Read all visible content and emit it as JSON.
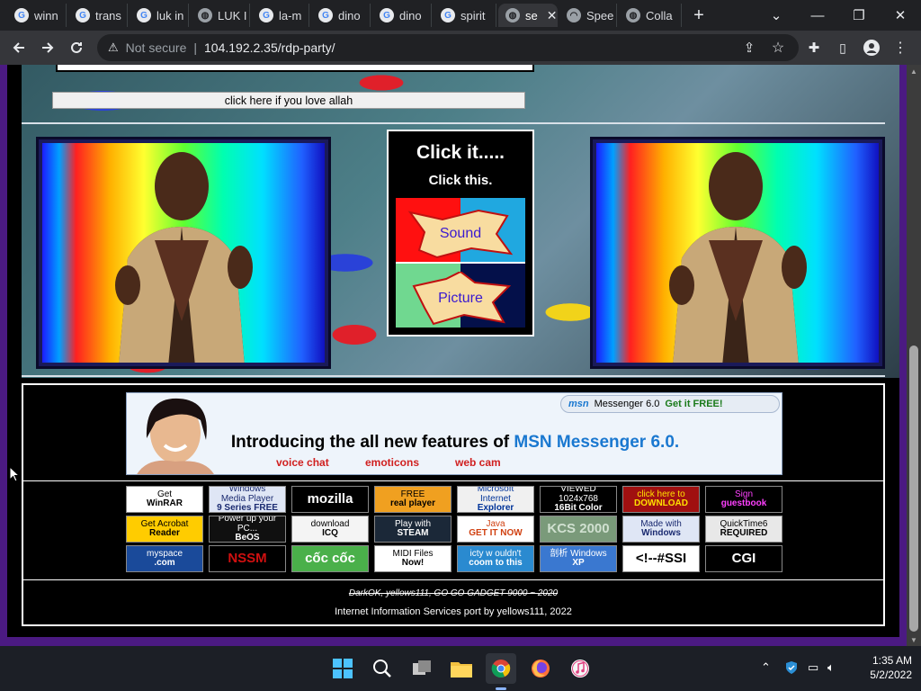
{
  "browser": {
    "tabs": [
      {
        "label": "winn",
        "icon": "google-icon"
      },
      {
        "label": "trans",
        "icon": "google-icon"
      },
      {
        "label": "luk in",
        "icon": "google-icon"
      },
      {
        "label": "LUK I",
        "icon": "globe-icon"
      },
      {
        "label": "la-m",
        "icon": "google-icon"
      },
      {
        "label": "dino",
        "icon": "google-icon"
      },
      {
        "label": "dino",
        "icon": "google-icon"
      },
      {
        "label": "spirit",
        "icon": "google-icon"
      },
      {
        "label": "se",
        "icon": "globe-icon",
        "active": true
      },
      {
        "label": "Spee",
        "icon": "speed-icon"
      },
      {
        "label": "Colla",
        "icon": "globe-icon"
      }
    ],
    "new_tab": "+",
    "security_label": "Not secure",
    "url": "104.192.2.35/rdp-party/",
    "window_controls": {
      "dropdown": "⌄",
      "minimize": "—",
      "restore": "❐",
      "close": "✕"
    }
  },
  "page": {
    "love_button_label": "click here if you love allah",
    "click_box": {
      "title": "Click it.....",
      "subtitle": "Click this.",
      "sound_label": "Sound",
      "picture_label": "Picture"
    },
    "msn_banner": {
      "tag_brand": "msn",
      "tag_product": "Messenger 6.0",
      "tag_free": "Get it FREE!",
      "headline_prefix": "Introducing the all new features of",
      "headline_highlight": "MSN Messenger 6.0.",
      "links": [
        "voice chat",
        "emoticons",
        "web cam"
      ]
    },
    "badges": [
      {
        "text": [
          "Get",
          "WinRAR"
        ],
        "bg": "#ffffff",
        "fg": "#000000"
      },
      {
        "text": [
          "Windows",
          "Media Player",
          "9 Series FREE"
        ],
        "bg": "#dfe6f5",
        "fg": "#1a2a70"
      },
      {
        "text": [
          "mozilla"
        ],
        "bg": "#000000",
        "fg": "#ffffff"
      },
      {
        "text": [
          "FREE",
          "real player"
        ],
        "bg": "#f0a020",
        "fg": "#000000"
      },
      {
        "text": [
          "Microsoft",
          "Internet",
          "Explorer"
        ],
        "bg": "#f0f0f0",
        "fg": "#003399"
      },
      {
        "text": [
          "VIEWED",
          "1024x768",
          "16Bit Color"
        ],
        "bg": "#000000",
        "fg": "#ffffff"
      },
      {
        "text": [
          "click here to",
          "DOWNLOAD"
        ],
        "bg": "#a01010",
        "fg": "#ffe000"
      },
      {
        "text": [
          "Sign",
          "guestbook"
        ],
        "bg": "#000000",
        "fg": "#ff40ff"
      },
      {
        "text": [
          "Get Acrobat",
          "Reader"
        ],
        "bg": "#ffcc00",
        "fg": "#000000"
      },
      {
        "text": [
          "Power up your PC...",
          "BeOS"
        ],
        "bg": "#101010",
        "fg": "#ffffff"
      },
      {
        "text": [
          "download",
          "ICQ"
        ],
        "bg": "#f4f4f4",
        "fg": "#000000"
      },
      {
        "text": [
          "Play with",
          "STEAM"
        ],
        "bg": "#1b2838",
        "fg": "#ffffff"
      },
      {
        "text": [
          "Java",
          "GET IT NOW"
        ],
        "bg": "#ffffff",
        "fg": "#d04010"
      },
      {
        "text": [
          "KCS 2000"
        ],
        "bg": "#7a9a7a",
        "fg": "#d0e0d0"
      },
      {
        "text": [
          "Made with",
          "Windows"
        ],
        "bg": "#dfe6f5",
        "fg": "#1a2a70"
      },
      {
        "text": [
          "QuickTime6",
          "REQUIRED"
        ],
        "bg": "#e8e8e8",
        "fg": "#000000"
      },
      {
        "text": [
          "myspace",
          ".com"
        ],
        "bg": "#1a4a9a",
        "fg": "#ffffff"
      },
      {
        "text": [
          "NSSM"
        ],
        "bg": "#000000",
        "fg": "#d01010"
      },
      {
        "text": [
          "cốc cốc"
        ],
        "bg": "#4ab04a",
        "fg": "#ffffff"
      },
      {
        "text": [
          "MIDI Files",
          "Now!"
        ],
        "bg": "#ffffff",
        "fg": "#000000"
      },
      {
        "text": [
          "icty w ouldn't",
          "coom to this"
        ],
        "bg": "#2a8ad0",
        "fg": "#ffffff"
      },
      {
        "text": [
          "剖析 Windows",
          "XP"
        ],
        "bg": "#3a78d0",
        "fg": "#ffffff"
      },
      {
        "text": [
          "<!--#SSI"
        ],
        "bg": "#ffffff",
        "fg": "#000000"
      },
      {
        "text": [
          "CGI"
        ],
        "bg": "#000000",
        "fg": "#ffffff"
      }
    ],
    "credit_line1": "DarkOK, yellows111, GO GO GADGET 9000 ~ 2020",
    "credit_line2": "Internet Information Services port by yellows111, 2022"
  },
  "taskbar": {
    "clock_time": "1:35 AM",
    "clock_date": "5/2/2022",
    "apps": [
      "windows-start-icon",
      "search-icon",
      "task-view-icon",
      "file-explorer-icon",
      "chrome-icon",
      "firefox-icon",
      "itunes-icon"
    ]
  },
  "colors": {
    "page_purple": "#4b1a82",
    "msn_blue": "#1a78d0",
    "msn_link_red": "#d02020"
  }
}
